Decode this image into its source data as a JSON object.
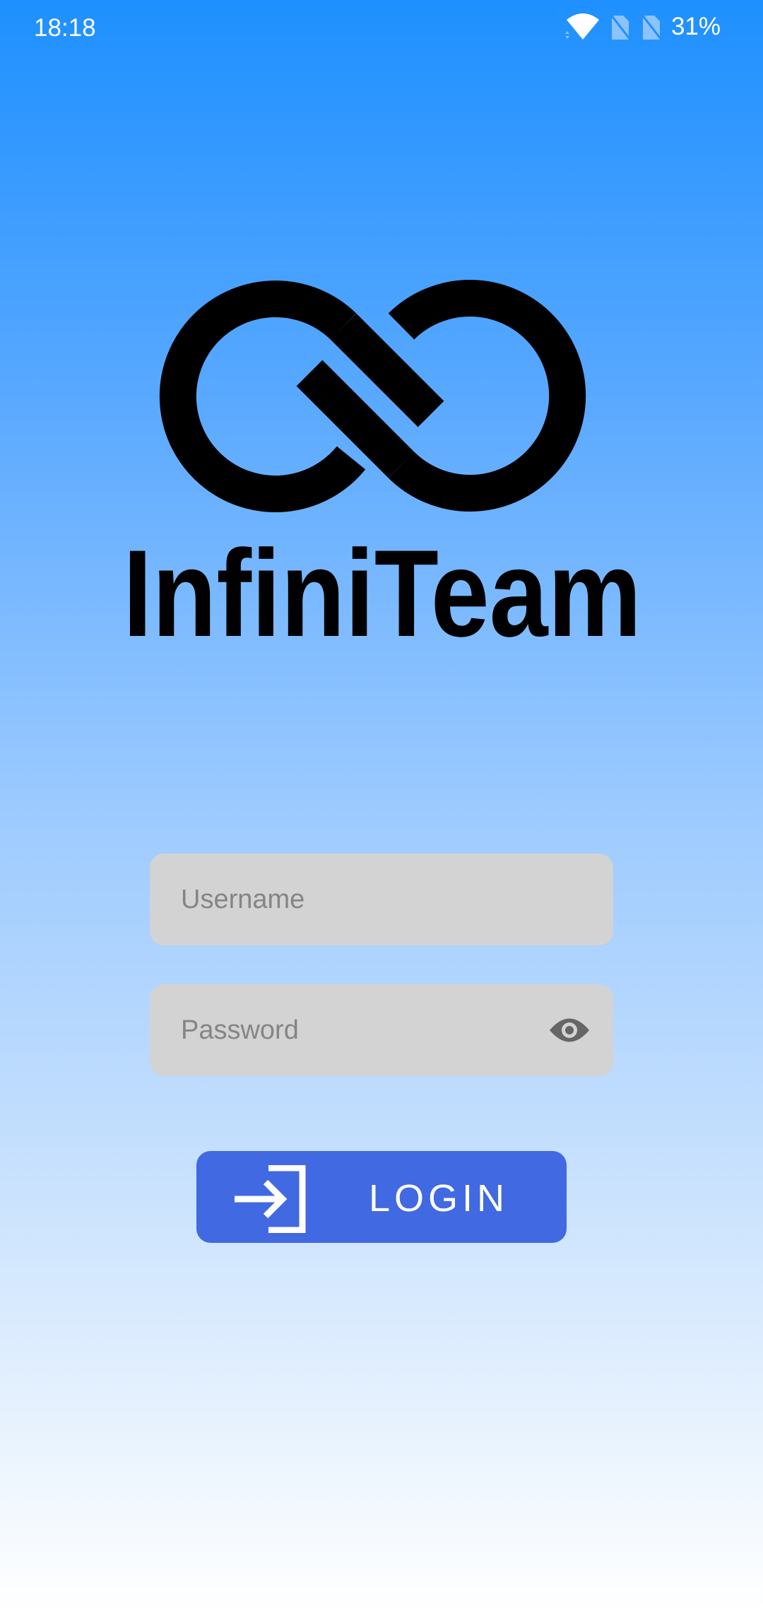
{
  "status_bar": {
    "time": "18:18",
    "battery": "31%",
    "icons": [
      "wifi-icon",
      "no-sim-icon",
      "no-sim-icon"
    ]
  },
  "logo": {
    "brand": "InfiniTeam"
  },
  "form": {
    "username_placeholder": "Username",
    "username_value": "",
    "password_placeholder": "Password",
    "password_value": "",
    "login_label": "LOGIN"
  },
  "colors": {
    "background_top": "#1E90FF",
    "button": "#4169E1",
    "field": "#D3D3D3"
  }
}
